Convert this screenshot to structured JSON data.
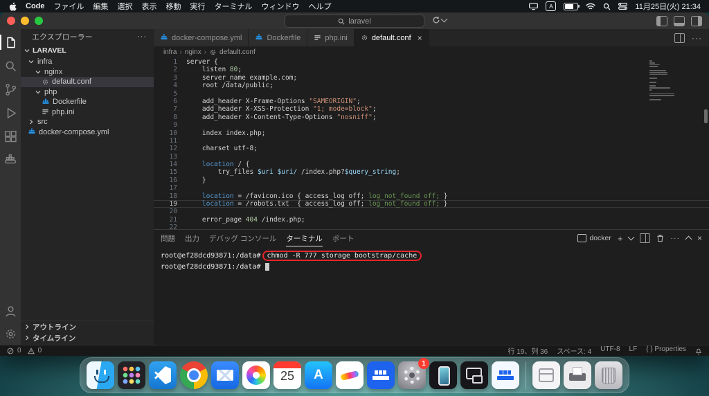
{
  "menubar": {
    "app_name": "Code",
    "items": [
      "ファイル",
      "編集",
      "選択",
      "表示",
      "移動",
      "実行",
      "ターミナル",
      "ウィンドウ",
      "ヘルプ"
    ],
    "input_source": "A",
    "clock": "11月25日(火) 21:34"
  },
  "titlebar": {
    "search_value": "laravel"
  },
  "sidebar": {
    "title": "エクスプローラー",
    "root_label": "LARAVEL",
    "tree": [
      {
        "label": "infra",
        "icon": "chevron-down",
        "indent": 0,
        "kind": "folder",
        "selected": false
      },
      {
        "label": "nginx",
        "icon": "chevron-down",
        "indent": 1,
        "kind": "folder",
        "selected": false
      },
      {
        "label": "default.conf",
        "icon": "gear",
        "indent": 2,
        "kind": "file",
        "selected": true
      },
      {
        "label": "php",
        "icon": "chevron-down",
        "indent": 1,
        "kind": "folder",
        "selected": false
      },
      {
        "label": "Dockerfile",
        "icon": "docker",
        "indent": 2,
        "kind": "file",
        "selected": false
      },
      {
        "label": "php.ini",
        "icon": "ini",
        "indent": 2,
        "kind": "file",
        "selected": false
      },
      {
        "label": "src",
        "icon": "chevron-right",
        "indent": 0,
        "kind": "folder",
        "selected": false
      },
      {
        "label": "docker-compose.yml",
        "icon": "docker",
        "indent": 0,
        "kind": "file",
        "selected": false
      }
    ],
    "bottom_sections": [
      "アウトライン",
      "タイムライン"
    ]
  },
  "editor": {
    "tabs": [
      {
        "label": "docker-compose.yml",
        "icon": "docker",
        "active": false
      },
      {
        "label": "Dockerfile",
        "icon": "docker",
        "active": false
      },
      {
        "label": "php.ini",
        "icon": "ini",
        "active": false
      },
      {
        "label": "default.conf",
        "icon": "gear",
        "active": true
      }
    ],
    "breadcrumb": [
      "infra",
      "nginx",
      "default.conf"
    ],
    "current_line": 19,
    "lines": [
      [
        {
          "c": "p",
          "t": "server {"
        }
      ],
      [
        {
          "c": "p",
          "t": "    listen "
        },
        {
          "c": "n",
          "t": "80"
        },
        {
          "c": "p",
          "t": ";"
        }
      ],
      [
        {
          "c": "p",
          "t": "    server_name example.com;"
        }
      ],
      [
        {
          "c": "p",
          "t": "    root /data/public;"
        }
      ],
      [],
      [
        {
          "c": "p",
          "t": "    add_header X-Frame-Options "
        },
        {
          "c": "s",
          "t": "\"SAMEORIGIN\""
        },
        {
          "c": "p",
          "t": ";"
        }
      ],
      [
        {
          "c": "p",
          "t": "    add_header X-XSS-Protection "
        },
        {
          "c": "s",
          "t": "\"1; mode=block\""
        },
        {
          "c": "p",
          "t": ";"
        }
      ],
      [
        {
          "c": "p",
          "t": "    add_header X-Content-Type-Options "
        },
        {
          "c": "s",
          "t": "\"nosniff\""
        },
        {
          "c": "p",
          "t": ";"
        }
      ],
      [],
      [
        {
          "c": "p",
          "t": "    index index.php;"
        }
      ],
      [],
      [
        {
          "c": "p",
          "t": "    charset utf-8;"
        }
      ],
      [],
      [
        {
          "c": "k",
          "t": "    location"
        },
        {
          "c": "p",
          "t": " / {"
        }
      ],
      [
        {
          "c": "p",
          "t": "        try_files "
        },
        {
          "c": "v",
          "t": "$uri"
        },
        {
          "c": "p",
          "t": " "
        },
        {
          "c": "v",
          "t": "$uri/"
        },
        {
          "c": "p",
          "t": " /index.php?"
        },
        {
          "c": "v",
          "t": "$query_string"
        },
        {
          "c": "p",
          "t": ";"
        }
      ],
      [
        {
          "c": "p",
          "t": "    }"
        }
      ],
      [],
      [
        {
          "c": "k",
          "t": "    location"
        },
        {
          "c": "p",
          "t": " = /favicon.ico { access_log off; "
        },
        {
          "c": "g",
          "t": "log_not_found off;"
        },
        {
          "c": "p",
          "t": " }"
        }
      ],
      [
        {
          "c": "k",
          "t": "    location"
        },
        {
          "c": "p",
          "t": " = /robots.txt  { access_log off; "
        },
        {
          "c": "g",
          "t": "log_not_found off;"
        },
        {
          "c": "p",
          "t": " }"
        }
      ],
      [],
      [
        {
          "c": "p",
          "t": "    error_page "
        },
        {
          "c": "n",
          "t": "404"
        },
        {
          "c": "p",
          "t": " /index.php;"
        }
      ],
      []
    ]
  },
  "panel": {
    "tabs": [
      "問題",
      "出力",
      "デバッグ コンソール",
      "ターミナル",
      "ポート"
    ],
    "active_tab": "ターミナル",
    "profile_label": "docker",
    "terminal": [
      {
        "prompt": "root@ef28dcd93871:/data#",
        "command": "chmod -R 777 storage bootstrap/cache",
        "annotated": true,
        "cursor": false
      },
      {
        "prompt": "root@ef28dcd93871:/data#",
        "command": "",
        "annotated": false,
        "cursor": true
      }
    ]
  },
  "statusbar": {
    "errors": "0",
    "warnings": "0",
    "items": [
      "行 19、列 36",
      "スペース: 4",
      "UTF-8",
      "LF",
      "{ } Properties"
    ]
  },
  "dock": {
    "items": [
      {
        "icon": "finder"
      },
      {
        "icon": "launchpad"
      },
      {
        "icon": "vscode"
      },
      {
        "icon": "chrome"
      },
      {
        "icon": "mail"
      },
      {
        "icon": "photos"
      },
      {
        "icon": "calendar",
        "label": "25"
      },
      {
        "icon": "app-store",
        "label": "A"
      },
      {
        "icon": "freeform"
      },
      {
        "icon": "docker"
      },
      {
        "icon": "settings",
        "badge": "1"
      },
      {
        "icon": "iphone-mirroring"
      },
      {
        "icon": "windows-app"
      },
      {
        "icon": "docker-alt"
      },
      {
        "icon": "divider"
      },
      {
        "icon": "downloads"
      },
      {
        "icon": "printer"
      },
      {
        "icon": "trash"
      }
    ]
  }
}
